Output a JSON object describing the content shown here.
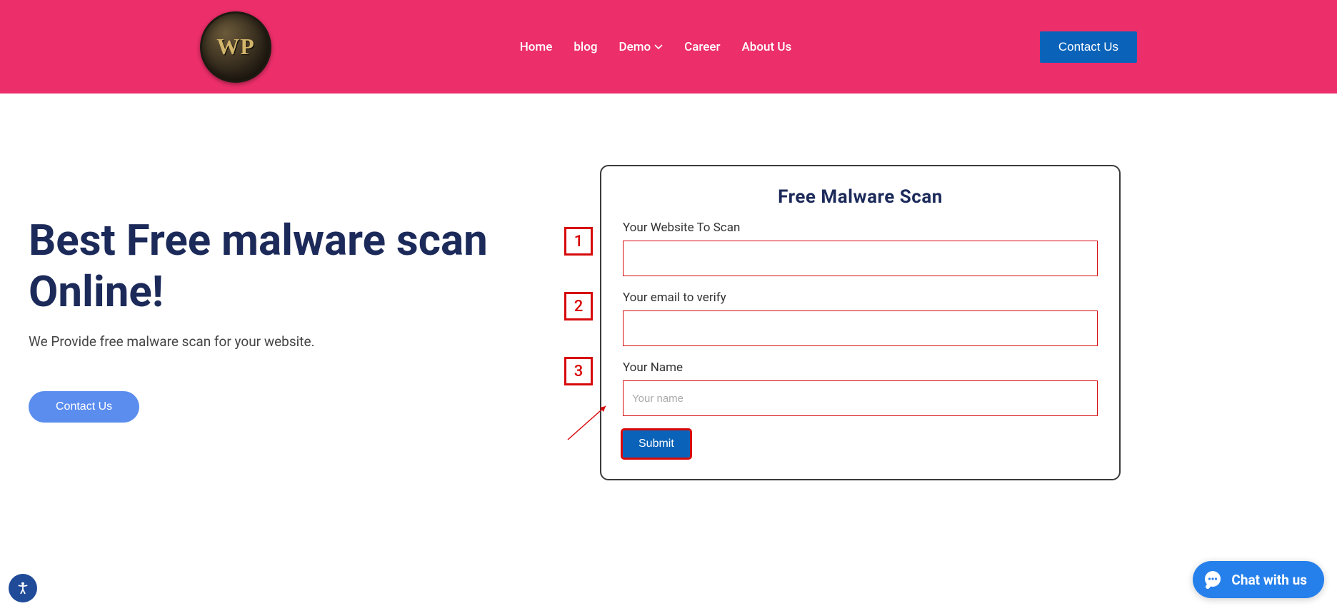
{
  "header": {
    "logo_text": "WP",
    "nav": [
      "Home",
      "blog",
      "Demo",
      "Career",
      "About Us"
    ],
    "cta": "Contact Us"
  },
  "hero": {
    "title": "Best Free malware scan Online!",
    "subtitle": "We Provide free malware scan for your website.",
    "cta": "Contact Us"
  },
  "form": {
    "title": "Free Malware Scan",
    "fields": [
      {
        "label": "Your Website To Scan",
        "placeholder": "",
        "value": ""
      },
      {
        "label": "Your email to verify",
        "placeholder": "",
        "value": ""
      },
      {
        "label": "Your Name",
        "placeholder": "Your name",
        "value": ""
      }
    ],
    "submit": "Submit",
    "markers": [
      "1",
      "2",
      "3"
    ]
  },
  "chat": {
    "label": "Chat with us"
  }
}
